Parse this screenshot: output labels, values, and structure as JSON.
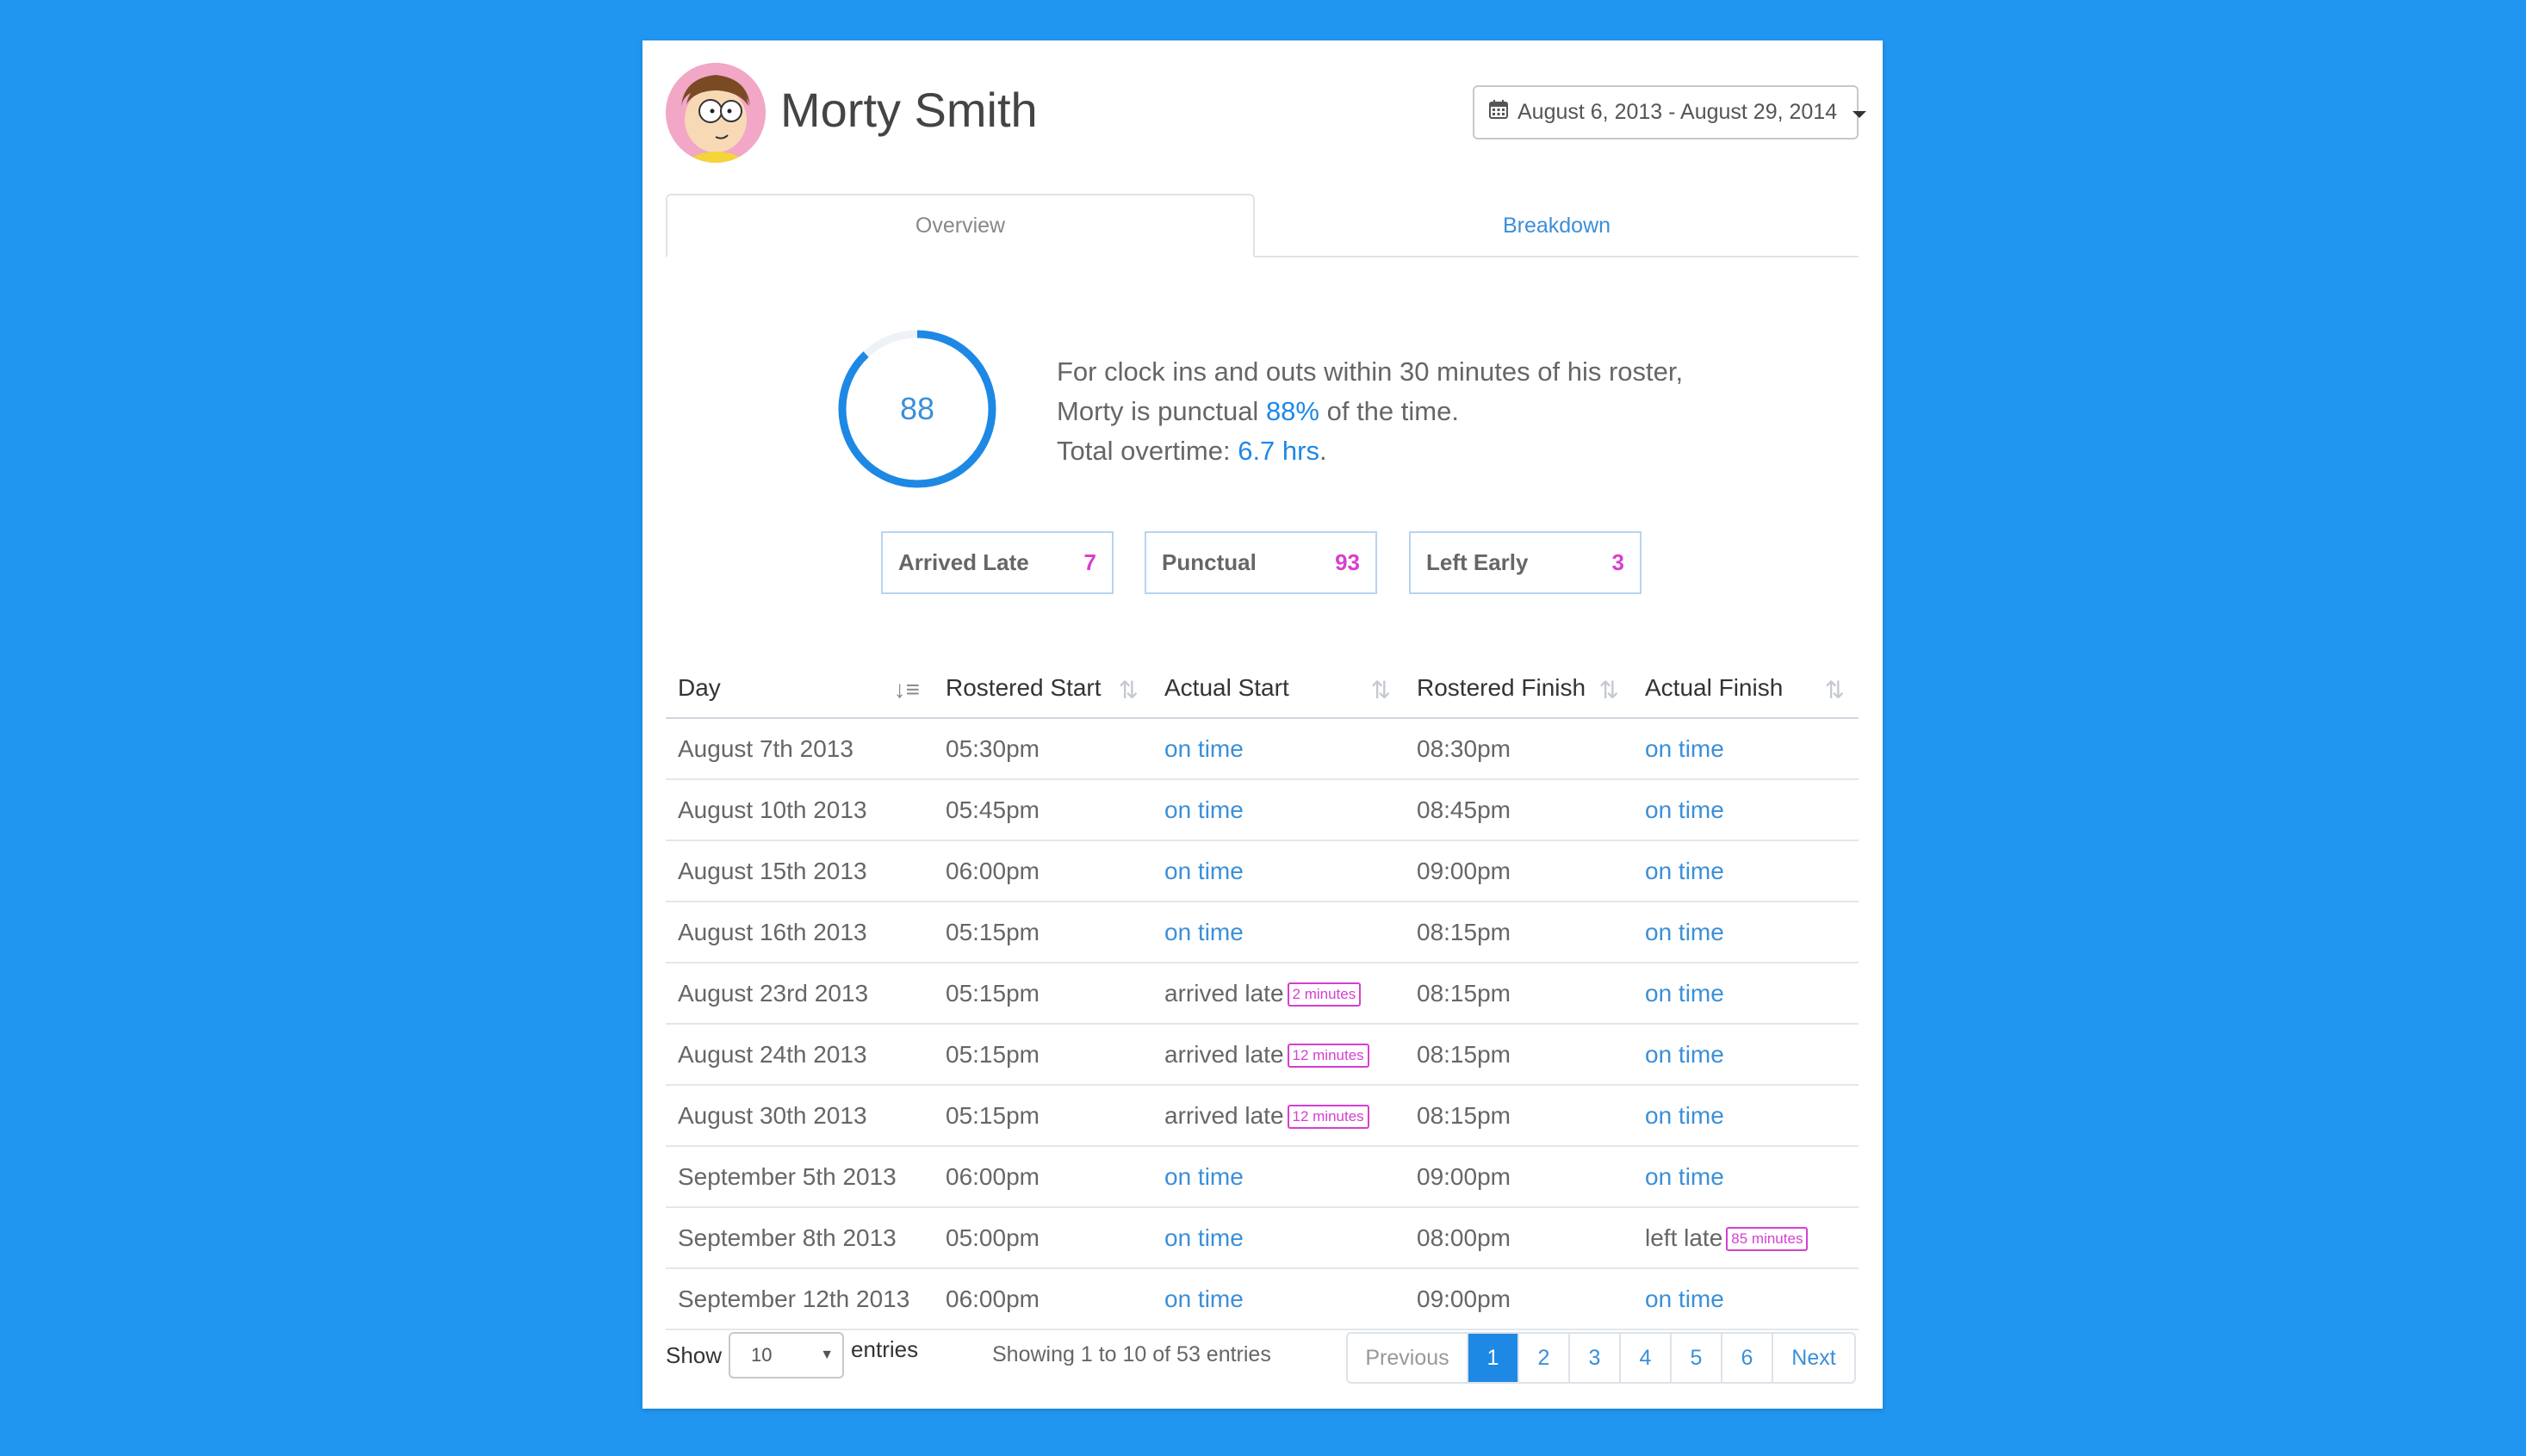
{
  "profile": {
    "name": "Morty Smith"
  },
  "date_range": {
    "label": "August 6, 2013 - August 29, 2014"
  },
  "tabs": [
    {
      "label": "Overview"
    },
    {
      "label": "Breakdown"
    }
  ],
  "summary": {
    "score": "88",
    "line1": "For clock ins and outs within 30 minutes of his roster,",
    "line2_pre": "Morty is punctual ",
    "line2_value": "88%",
    "line2_post": " of the time.",
    "line3_pre": "Total overtime: ",
    "line3_value": "6.7 hrs",
    "line3_post": "."
  },
  "stats": [
    {
      "label": "Arrived Late",
      "value": "7"
    },
    {
      "label": "Punctual",
      "value": "93"
    },
    {
      "label": "Left Early",
      "value": "3"
    }
  ],
  "table": {
    "headers": [
      "Day",
      "Rostered Start",
      "Actual Start",
      "Rostered Finish",
      "Actual Finish"
    ],
    "rows": [
      [
        "August 7th 2013",
        "05:30pm",
        "on time",
        "",
        "08:30pm",
        "on time",
        ""
      ],
      [
        "August 10th 2013",
        "05:45pm",
        "on time",
        "",
        "08:45pm",
        "on time",
        ""
      ],
      [
        "August 15th 2013",
        "06:00pm",
        "on time",
        "",
        "09:00pm",
        "on time",
        ""
      ],
      [
        "August 16th 2013",
        "05:15pm",
        "on time",
        "",
        "08:15pm",
        "on time",
        ""
      ],
      [
        "August 23rd 2013",
        "05:15pm",
        "arrived late",
        "2 minutes",
        "08:15pm",
        "on time",
        ""
      ],
      [
        "August 24th 2013",
        "05:15pm",
        "arrived late",
        "12 minutes",
        "08:15pm",
        "on time",
        ""
      ],
      [
        "August 30th 2013",
        "05:15pm",
        "arrived late",
        "12 minutes",
        "08:15pm",
        "on time",
        ""
      ],
      [
        "September 5th 2013",
        "06:00pm",
        "on time",
        "",
        "09:00pm",
        "on time",
        ""
      ],
      [
        "September 8th 2013",
        "05:00pm",
        "on time",
        "",
        "08:00pm",
        "left late",
        "85 minutes"
      ],
      [
        "September 12th 2013",
        "06:00pm",
        "on time",
        "",
        "09:00pm",
        "on time",
        ""
      ]
    ]
  },
  "footer": {
    "show_label": "Show",
    "page_size": "10",
    "entries_label": "entries",
    "info": "Showing 1 to 10 of 53 entries",
    "pager": {
      "previous": "Previous",
      "pages": [
        "1",
        "2",
        "3",
        "4",
        "5",
        "6"
      ],
      "active": "1",
      "next": "Next"
    }
  },
  "colors": {
    "accent": "#1e88e5",
    "highlight": "#d63fd1",
    "background": "#2196f0"
  },
  "progress": {
    "gauge_percent": 88
  }
}
